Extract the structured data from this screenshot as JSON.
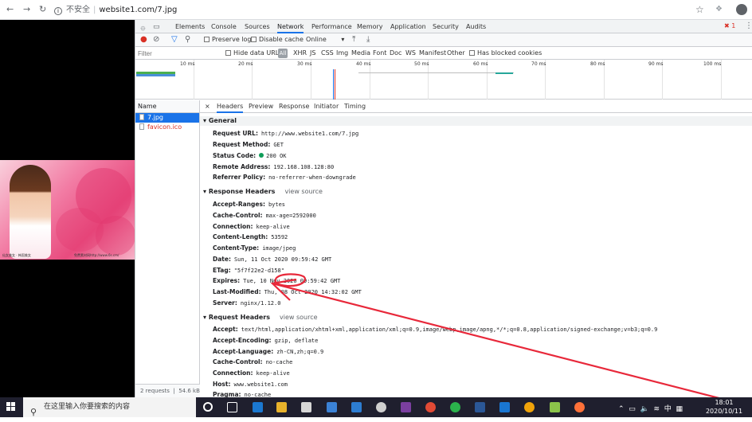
{
  "browser": {
    "url_insecure": "不安全",
    "url_separator": "|",
    "url": "website1.com/7.jpg"
  },
  "page": {
    "image_caption_left": "仙女美女 · 韩国美女",
    "image_caption_right": "免费素材网http://www.6s.cm/"
  },
  "devtools": {
    "tabs": [
      "Elements",
      "Console",
      "Sources",
      "Network",
      "Performance",
      "Memory",
      "Application",
      "Security",
      "Audits"
    ],
    "active_tab": "Network",
    "error_count": "1",
    "toolbar": {
      "preserve_log": "Preserve log",
      "disable_cache": "Disable cache",
      "throttle": "Online"
    },
    "filter": {
      "placeholder": "Filter",
      "hide_data_urls": "Hide data URLs",
      "types": [
        "All",
        "XHR",
        "JS",
        "CSS",
        "Img",
        "Media",
        "Font",
        "Doc",
        "WS",
        "Manifest",
        "Other"
      ],
      "blocked_cookies": "Has blocked cookies"
    },
    "timeline_ticks": [
      "10 ms",
      "20 ms",
      "30 ms",
      "40 ms",
      "50 ms",
      "60 ms",
      "70 ms",
      "80 ms",
      "90 ms",
      "100 ms"
    ],
    "name_column": "Name",
    "requests": [
      {
        "name": "7.jpg",
        "selected": true
      },
      {
        "name": "favicon.ico",
        "selected": false
      }
    ],
    "summary": {
      "requests": "2 requests",
      "size": "54.6 kB"
    },
    "detail_tabs": [
      "Headers",
      "Preview",
      "Response",
      "Initiator",
      "Timing"
    ],
    "close_glyph": "×",
    "general": {
      "title": "General",
      "rows": [
        {
          "k": "Request URL:",
          "v": "http://www.website1.com/7.jpg"
        },
        {
          "k": "Request Method:",
          "v": "GET"
        },
        {
          "k": "Status Code:",
          "v": "200 OK"
        },
        {
          "k": "Remote Address:",
          "v": "192.168.108.128:80"
        },
        {
          "k": "Referrer Policy:",
          "v": "no-referrer-when-downgrade"
        }
      ]
    },
    "response_headers": {
      "title": "Response Headers",
      "view_source": "view source",
      "rows": [
        {
          "k": "Accept-Ranges:",
          "v": "bytes"
        },
        {
          "k": "Cache-Control:",
          "v": "max-age=2592000"
        },
        {
          "k": "Connection:",
          "v": "keep-alive"
        },
        {
          "k": "Content-Length:",
          "v": "53592"
        },
        {
          "k": "Content-Type:",
          "v": "image/jpeg"
        },
        {
          "k": "Date:",
          "v": "Sun, 11 Oct 2020 09:59:42 GMT"
        },
        {
          "k": "ETag:",
          "v": "\"5f7f22e2-d158\""
        },
        {
          "k": "Expires:",
          "v": "Tue, 10 Nov 2020 09:59:42 GMT"
        },
        {
          "k": "Last-Modified:",
          "v": "Thu, 08 Oct 2020 14:32:02 GMT"
        },
        {
          "k": "Server:",
          "v": "nginx/1.12.0"
        }
      ]
    },
    "request_headers": {
      "title": "Request Headers",
      "view_source": "view source",
      "rows": [
        {
          "k": "Accept:",
          "v": "text/html,application/xhtml+xml,application/xml;q=0.9,image/webp,image/apng,*/*;q=0.8,application/signed-exchange;v=b3;q=0.9"
        },
        {
          "k": "Accept-Encoding:",
          "v": "gzip, deflate"
        },
        {
          "k": "Accept-Language:",
          "v": "zh-CN,zh;q=0.9"
        },
        {
          "k": "Cache-Control:",
          "v": "no-cache"
        },
        {
          "k": "Connection:",
          "v": "keep-alive"
        },
        {
          "k": "Host:",
          "v": "www.website1.com"
        },
        {
          "k": "Pragma:",
          "v": "no-cache"
        }
      ]
    },
    "annotation_color": "#e8283a"
  },
  "taskbar": {
    "search_placeholder": "在这里输入你要搜索的内容",
    "ime": "中",
    "time": "18:01",
    "date": "2020/10/11"
  }
}
